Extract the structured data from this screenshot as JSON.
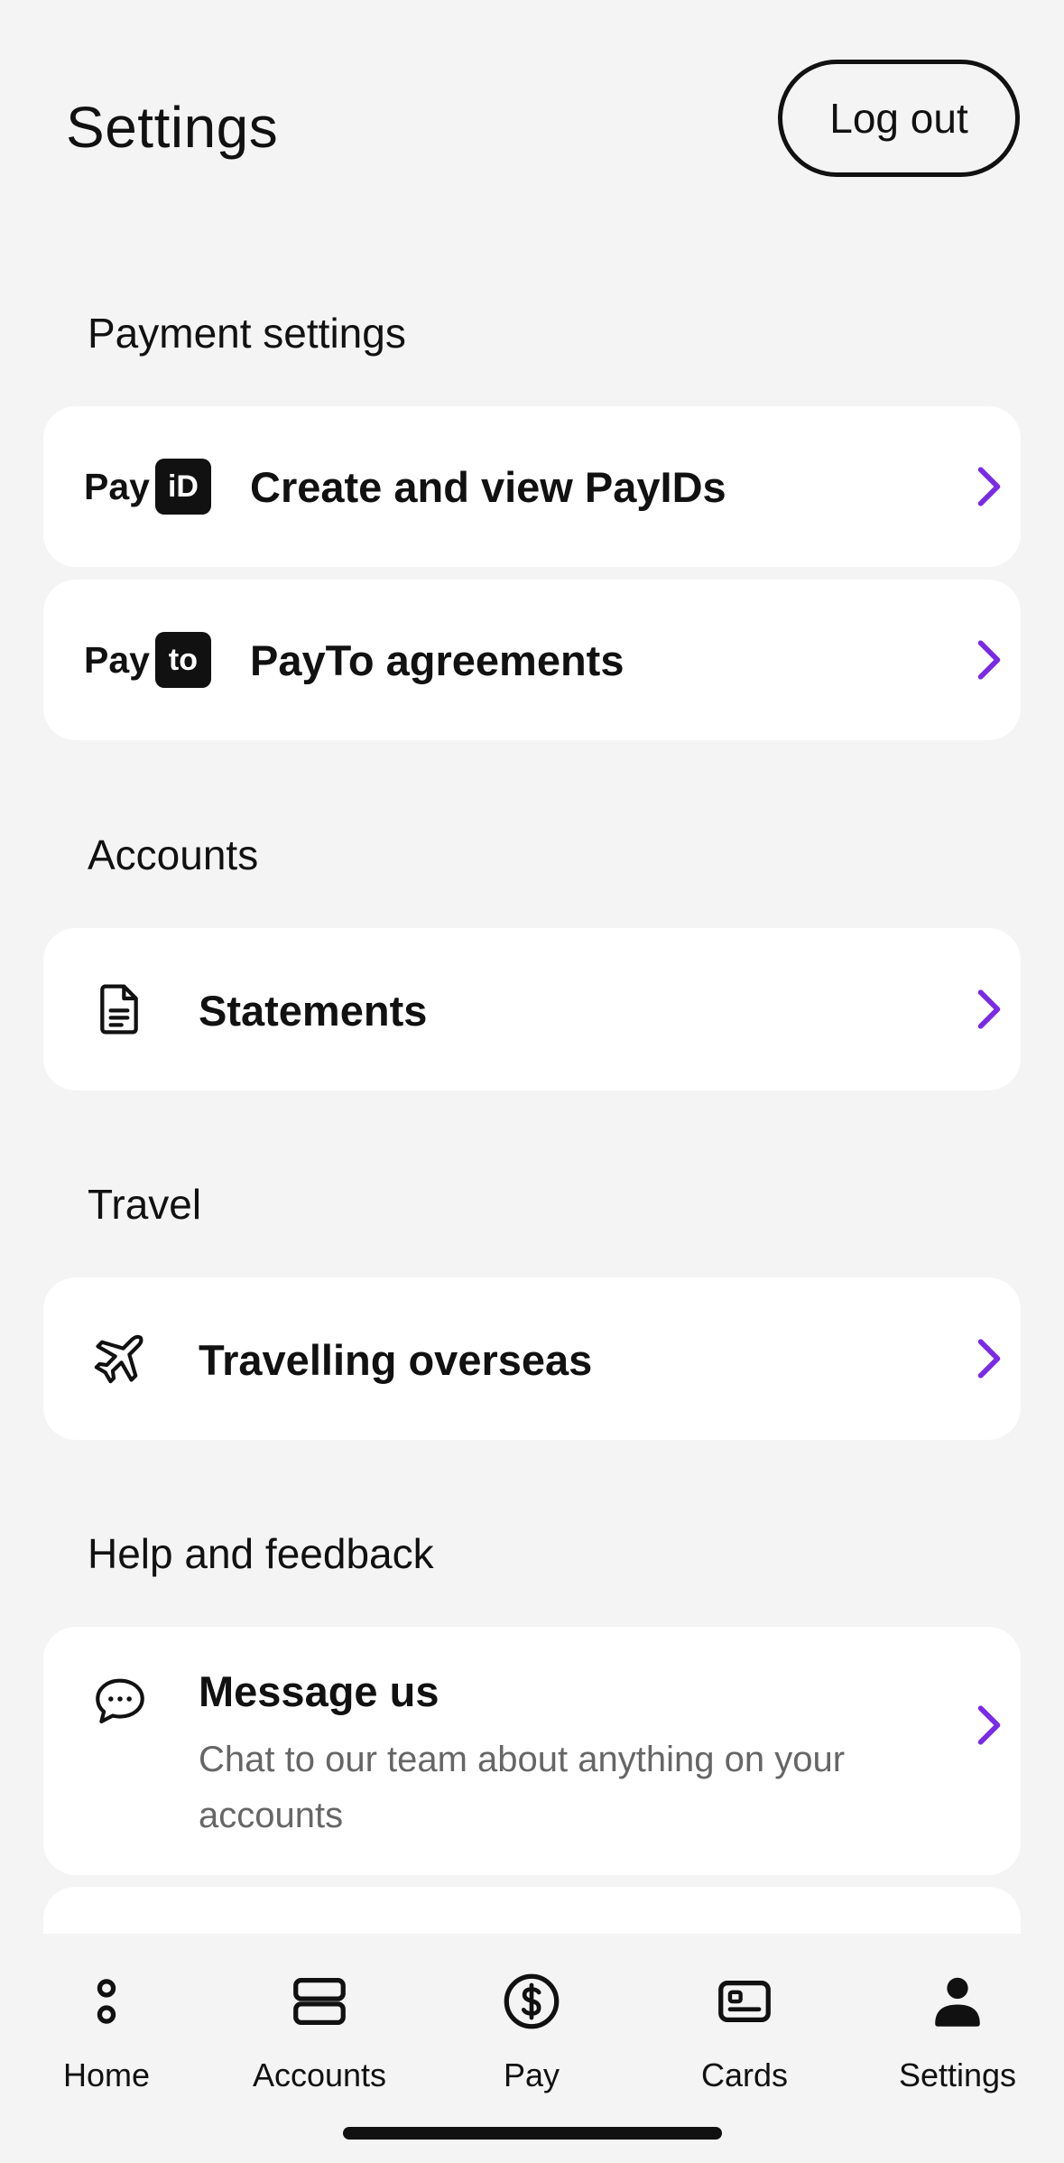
{
  "header": {
    "title": "Settings",
    "logout_label": "Log out"
  },
  "sections": {
    "payment": {
      "title": "Payment settings",
      "payid": {
        "logo_pay": "Pay",
        "logo_mark": "iD",
        "label": "Create and view PayIDs",
        "icon": "payid-logo-icon"
      },
      "payto": {
        "logo_pay": "Pay",
        "logo_mark": "to",
        "label": "PayTo agreements",
        "icon": "payto-logo-icon"
      }
    },
    "accounts": {
      "title": "Accounts",
      "statements": {
        "label": "Statements",
        "icon": "document-icon"
      }
    },
    "travel": {
      "title": "Travel",
      "overseas": {
        "label": "Travelling overseas",
        "icon": "airplane-icon"
      }
    },
    "help": {
      "title": "Help and feedback",
      "message": {
        "label": "Message us",
        "sub_line1": "Chat to our team about anything on your",
        "sub_line2": "accounts",
        "icon": "chat-bubble-icon"
      }
    }
  },
  "tabbar": {
    "tabs": [
      {
        "label": "Home",
        "icon": "home-dots-icon"
      },
      {
        "label": "Accounts",
        "icon": "accounts-stack-icon"
      },
      {
        "label": "Pay",
        "icon": "dollar-circle-icon"
      },
      {
        "label": "Cards",
        "icon": "card-icon"
      },
      {
        "label": "Settings",
        "icon": "person-icon",
        "active": true
      }
    ]
  },
  "colors": {
    "accent": "#7a2be6",
    "background": "#f4f4f5",
    "card": "#ffffff",
    "text": "#111111",
    "muted": "#666666"
  }
}
